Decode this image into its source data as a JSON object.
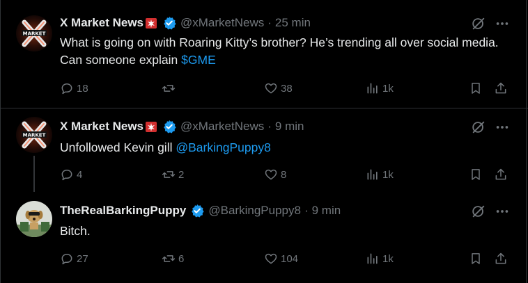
{
  "colors": {
    "background": "#000000",
    "text": "#e7e9ea",
    "muted": "#71767b",
    "link": "#1d9bf0",
    "verified": "#1d9bf0",
    "divider": "#2f3336"
  },
  "tweets": [
    {
      "name": "X Market News",
      "name_emoji": "siren-icon",
      "verified": true,
      "handle": "@xMarketNews",
      "separator": "·",
      "time": "25 min",
      "text": "What is going on with Roaring Kitty’s brother? He’s trending all over social media. Can someone explain ",
      "link": "$GME",
      "avatar_label": "MARKET",
      "stats": {
        "replies": "18",
        "reposts": "",
        "likes": "38",
        "views": "1k"
      }
    },
    {
      "name": "X Market News",
      "name_emoji": "siren-icon",
      "verified": true,
      "handle": "@xMarketNews",
      "separator": "·",
      "time": "9 min",
      "text": "Unfollowed Kevin gill ",
      "link": "@BarkingPuppy8",
      "avatar_label": "MARKET",
      "stats": {
        "replies": "4",
        "reposts": "2",
        "likes": "8",
        "views": "1k"
      }
    },
    {
      "name": "TheRealBarkingPuppy",
      "verified": true,
      "handle": "@BarkingPuppy8",
      "separator": "·",
      "time": "9 min",
      "text": "Bitch.",
      "stats": {
        "replies": "27",
        "reposts": "6",
        "likes": "104",
        "views": "1k"
      }
    }
  ]
}
